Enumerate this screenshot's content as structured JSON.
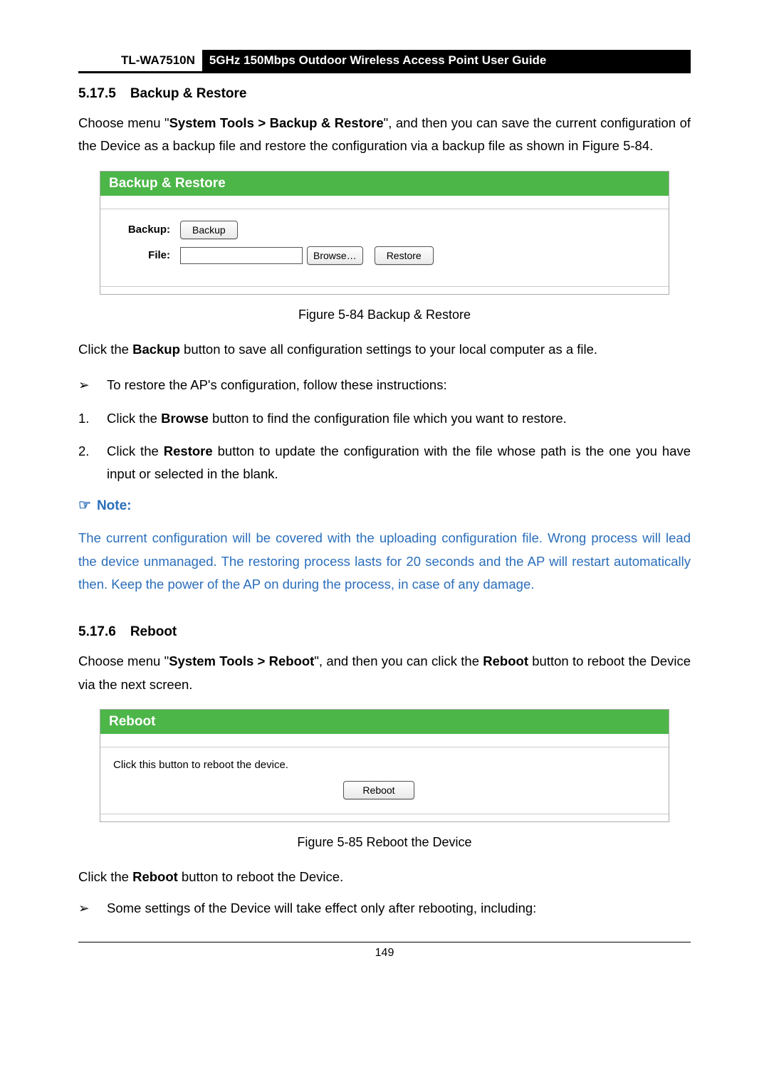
{
  "header": {
    "model": "TL-WA7510N",
    "title": "5GHz 150Mbps Outdoor Wireless Access Point User Guide"
  },
  "section_backup": {
    "number": "5.17.5",
    "title": "Backup & Restore"
  },
  "intro1_a": "Choose menu \"",
  "intro1_b": "System Tools > Backup & Restore",
  "intro1_c": "\", and then you can save the current configuration of the Device as a backup file and restore the configuration via a backup file as shown in Figure 5-84.",
  "panel_backup": {
    "title": "Backup & Restore",
    "label_backup": "Backup:",
    "label_file": "File:",
    "btn_backup": "Backup",
    "btn_browse": "Browse…",
    "btn_restore": "Restore"
  },
  "caption1": "Figure 5-84 Backup & Restore",
  "click_backup_a": "Click the ",
  "click_backup_b": "Backup",
  "click_backup_c": " button to save all configuration settings to your local computer as a file.",
  "bullet_restore": "To restore the AP's configuration, follow these instructions:",
  "step1_a": "Click the ",
  "step1_b": "Browse",
  "step1_c": " button to find the configuration file which you want to restore.",
  "step2_a": "Click the ",
  "step2_b": "Restore",
  "step2_c": " button to update the configuration with the file whose path is the one you have input or selected in the blank.",
  "note_label": "Note:",
  "note_body": "The current configuration will be covered with the uploading configuration file. Wrong process will lead the device unmanaged. The restoring process lasts for 20 seconds and the AP will restart automatically then. Keep the power of the AP on during the process, in case of any damage.",
  "section_reboot": {
    "number": "5.17.6",
    "title": "Reboot"
  },
  "intro2_a": "Choose menu \"",
  "intro2_b": "System Tools > Reboot",
  "intro2_c": "\", and then you can click the ",
  "intro2_d": "Reboot",
  "intro2_e": " button to reboot the Device via the next screen.",
  "panel_reboot": {
    "title": "Reboot",
    "text": "Click this button to reboot the device.",
    "btn": "Reboot"
  },
  "caption2": "Figure 5-85 Reboot the Device",
  "click_reboot_a": "Click the ",
  "click_reboot_b": "Reboot",
  "click_reboot_c": " button to reboot the Device.",
  "bullet_settings": "Some settings of the Device will take effect only after rebooting, including:",
  "markers": {
    "tri": "➢",
    "one": "1.",
    "two": "2.",
    "hand": "☞"
  },
  "page_number": "149",
  "chart_data": null
}
